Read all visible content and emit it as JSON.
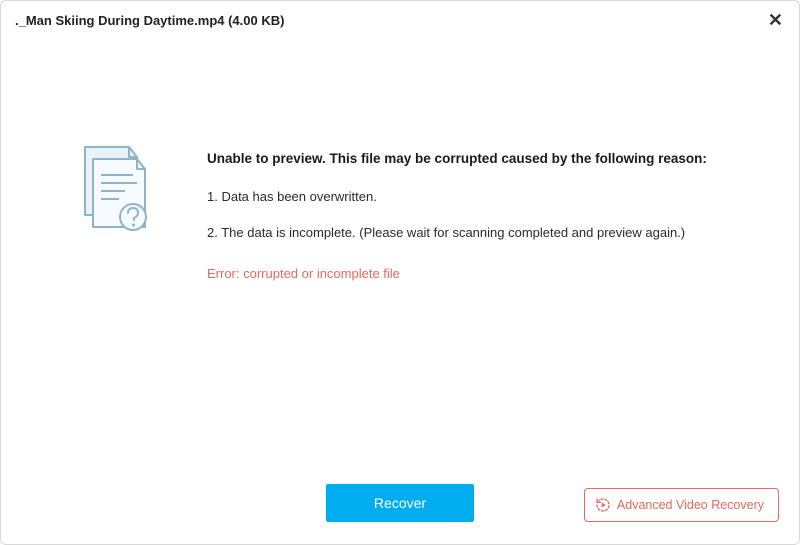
{
  "titlebar": {
    "filename": "._Man Skiing During Daytime.mp4 (4.00  KB)"
  },
  "headline": "Unable to preview. This file may be corrupted caused by the following reason:",
  "reasons": {
    "r1": "1. Data has been overwritten.",
    "r2": "2. The data is incomplete. (Please wait for scanning completed and preview again.)"
  },
  "error": "Error: corrupted or incomplete file",
  "buttons": {
    "recover": "Recover",
    "advanced": "Advanced Video Recovery"
  },
  "colors": {
    "primary": "#00aeef",
    "error": "#e36a5c"
  }
}
